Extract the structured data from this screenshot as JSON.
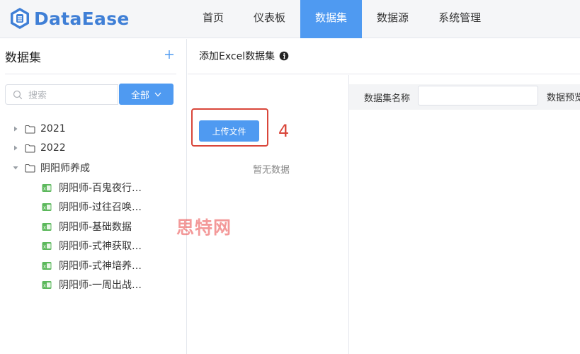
{
  "brand": {
    "name": "DataEase",
    "color": "#3f7fd6"
  },
  "nav": {
    "items": [
      {
        "label": "首页"
      },
      {
        "label": "仪表板"
      },
      {
        "label": "数据集",
        "active": true
      },
      {
        "label": "数据源"
      },
      {
        "label": "系统管理"
      }
    ]
  },
  "sidebar": {
    "title": "数据集",
    "add_icon": "plus-icon",
    "search": {
      "placeholder": "搜索"
    },
    "filter": {
      "label": "全部"
    },
    "tree": [
      {
        "label": "2021",
        "type": "folder",
        "expanded": false
      },
      {
        "label": "2022",
        "type": "folder",
        "expanded": false
      },
      {
        "label": "阴阳师养成",
        "type": "folder",
        "expanded": true
      },
      {
        "label": "阴阳师-百鬼夜行…",
        "type": "excel"
      },
      {
        "label": "阴阳师-过往召唤…",
        "type": "excel"
      },
      {
        "label": "阴阳师-基础数据",
        "type": "excel"
      },
      {
        "label": "阴阳师-式神获取…",
        "type": "excel"
      },
      {
        "label": "阴阳师-式神培养…",
        "type": "excel"
      },
      {
        "label": "阴阳师-一周出战…",
        "type": "excel"
      }
    ]
  },
  "main": {
    "title": "添加Excel数据集",
    "upload_label": "上传文件",
    "step_number": "4",
    "empty_text": "暂无数据",
    "dataset_name_label": "数据集名称",
    "dataset_name_value": "",
    "preview_label": "数据预览"
  },
  "watermark": "思特网",
  "colors": {
    "accent": "#4f9af1",
    "highlight": "#d9463a"
  }
}
